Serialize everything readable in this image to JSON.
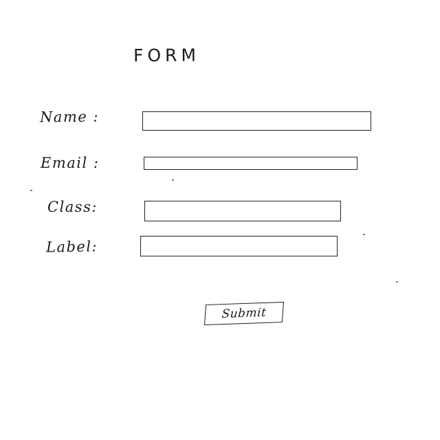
{
  "form": {
    "title": "FORM",
    "fields": [
      {
        "label": "Name :",
        "value": ""
      },
      {
        "label": "Email :",
        "value": ""
      },
      {
        "label": "Class:",
        "value": ""
      },
      {
        "label": "Label:",
        "value": ""
      }
    ],
    "submit_label": "Submit"
  }
}
